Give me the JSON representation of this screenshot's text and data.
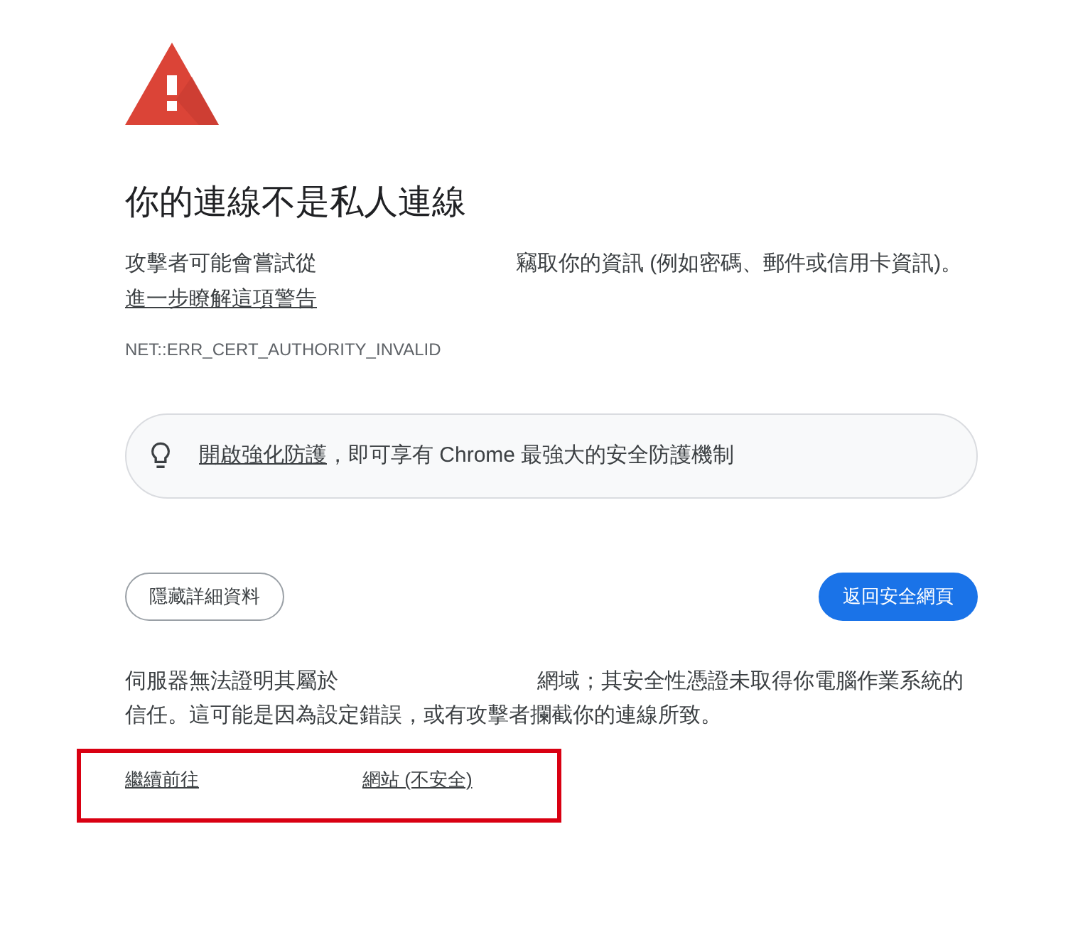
{
  "warning": {
    "title": "你的連線不是私人連線",
    "intro": [
      "攻擊者可能會嘗試從",
      "竊取你的資訊 (例如密碼、郵件或信用卡資訊)。"
    ],
    "learn_more_link": "進一步瞭解這項警告",
    "error_code": "NET::ERR_CERT_AUTHORITY_INVALID"
  },
  "enhanced_protection": {
    "link": "開啟強化防護",
    "text": "，即可享有 Chrome 最強大的安全防護機制"
  },
  "buttons": [
    {
      "label": "隱藏詳細資料",
      "kind": "secondary"
    },
    {
      "label": "返回安全網頁",
      "kind": "primary"
    }
  ],
  "details": {
    "explanation": [
      "伺服器無法證明其屬於",
      "網域；其安全性憑證未取得你電腦作業系統的信任。這可能是因為設定錯誤，或有攻擊者攔截你的連線所致。"
    ],
    "proceed_link": [
      "繼續前往",
      "網站 (不安全)"
    ],
    "highlighted": true
  }
}
